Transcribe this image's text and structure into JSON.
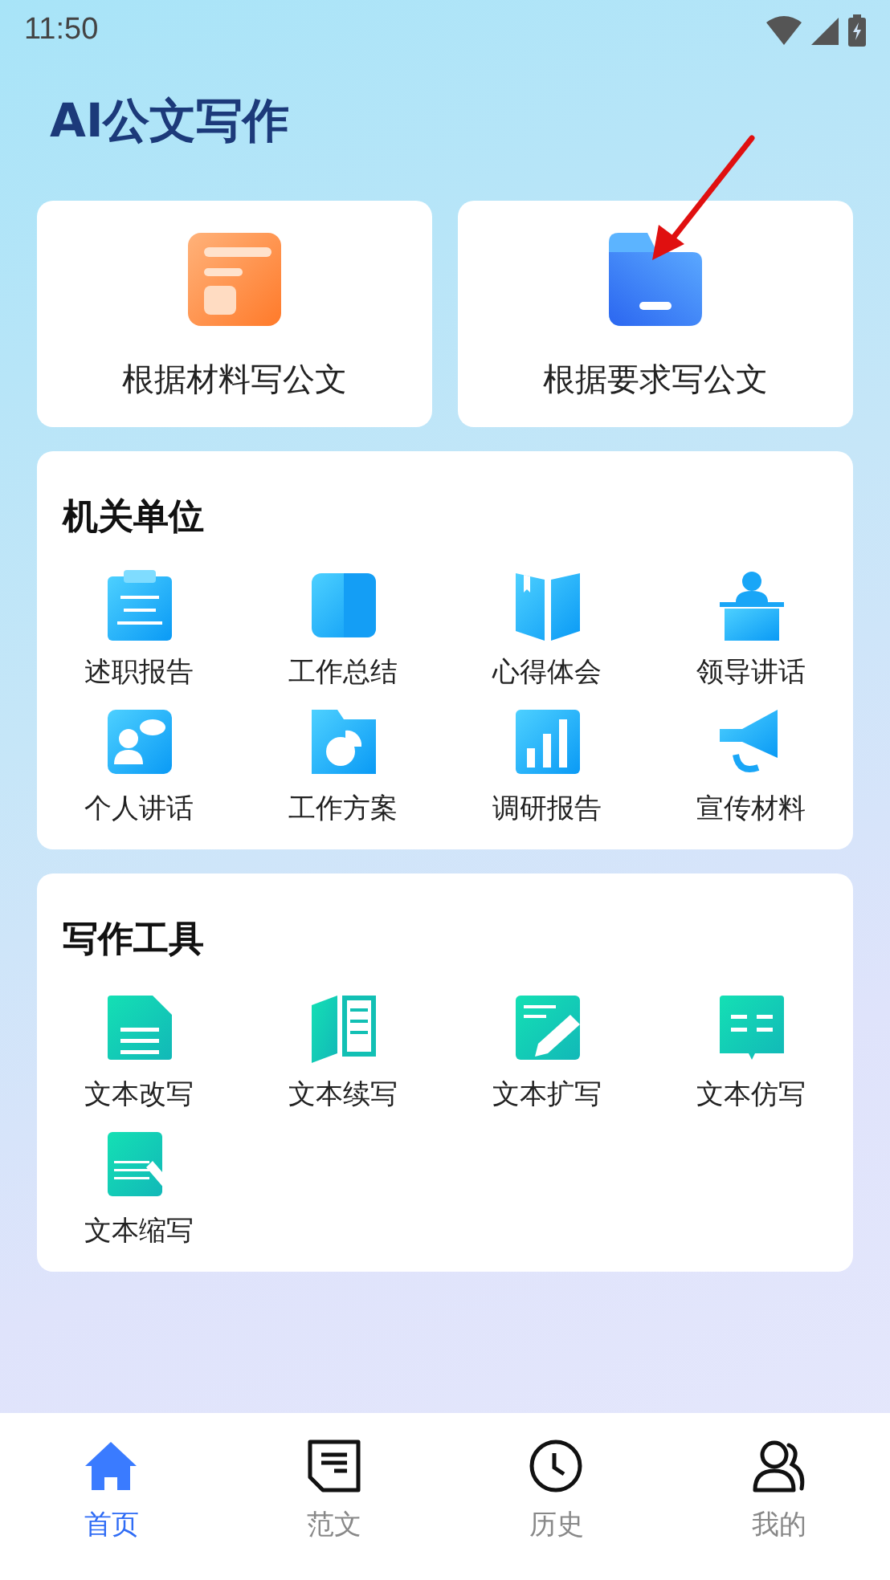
{
  "status_bar": {
    "time": "11:50"
  },
  "title": "AI公文写作",
  "quick_actions": [
    {
      "label": "根据材料写公文"
    },
    {
      "label": "根据要求写公文"
    }
  ],
  "sections": [
    {
      "title": "机关单位",
      "items": [
        "述职报告",
        "工作总结",
        "心得体会",
        "领导讲话",
        "个人讲话",
        "工作方案",
        "调研报告",
        "宣传材料"
      ]
    },
    {
      "title": "写作工具",
      "items": [
        "文本改写",
        "文本续写",
        "文本扩写",
        "文本仿写",
        "文本缩写"
      ]
    }
  ],
  "tabs": [
    {
      "label": "首页",
      "selected": true
    },
    {
      "label": "范文",
      "selected": false
    },
    {
      "label": "历史",
      "selected": false
    },
    {
      "label": "我的",
      "selected": false
    }
  ]
}
